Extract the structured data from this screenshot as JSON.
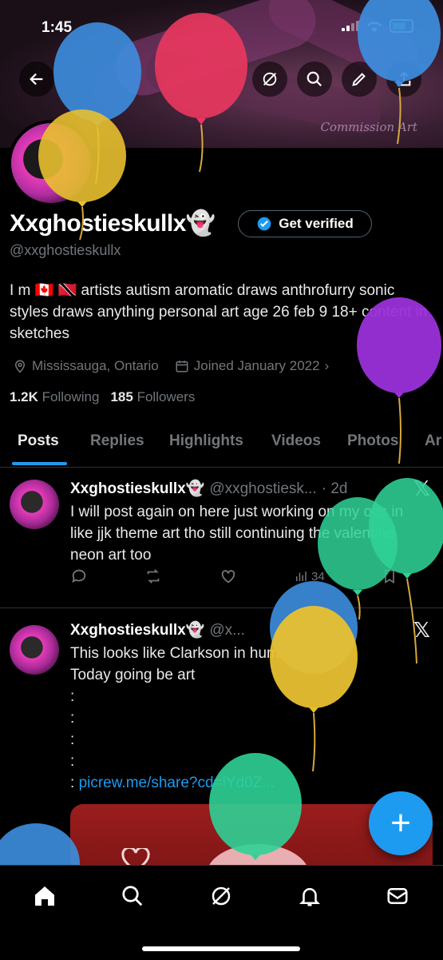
{
  "status_bar": {
    "time": "1:45"
  },
  "banner": {
    "watermark": "Commission Art"
  },
  "profile": {
    "display_name": "Xxghostieskullx👻",
    "verify_label": "Get verified",
    "handle": "@xxghostieskullx",
    "bio": "I m 🇨🇦 🇹🇹 artists autism aromatic draws anthrofurry sonic styles draws anything personal art age 26 feb 9 18+ content in sketches",
    "location": "Mississauga, Ontario",
    "joined": "Joined January 2022",
    "following_count": "1.2K",
    "following_label": "Following",
    "followers_count": "185",
    "followers_label": "Followers"
  },
  "tabs": [
    {
      "label": "Posts"
    },
    {
      "label": "Replies"
    },
    {
      "label": "Highlights"
    },
    {
      "label": "Videos"
    },
    {
      "label": "Photos"
    },
    {
      "label": "Ar"
    }
  ],
  "posts": [
    {
      "name": "Xxghostieskullx👻",
      "handle": "@xxghostiesk...",
      "time": "· 2d",
      "text": "I will post again on here just working on my ocs in like jjk theme art tho still continuing the valentine neon art too",
      "views": "34"
    },
    {
      "name": "Xxghostieskullx👻",
      "handle": "@x...",
      "text_line1": "This looks like Clarkson in human form",
      "text_line2": "Today going be art",
      "colons": [
        ":",
        ":",
        ":",
        ":"
      ],
      "link_prefix": ": ",
      "link": "picrew.me/share?cd=iYd0Z..."
    }
  ],
  "compose_label": "+",
  "icons": [
    "back-arrow-icon",
    "grok-icon",
    "search-icon",
    "edit-icon",
    "share-icon",
    "location-icon",
    "calendar-icon",
    "reply-icon",
    "repost-icon",
    "like-icon",
    "views-icon",
    "bookmark-icon",
    "home-icon",
    "explore-icon",
    "grok-nav-icon",
    "notifications-icon",
    "messages-icon"
  ],
  "colors": {
    "accent": "#1d9bf0",
    "background": "#000000",
    "muted": "#71767b"
  }
}
